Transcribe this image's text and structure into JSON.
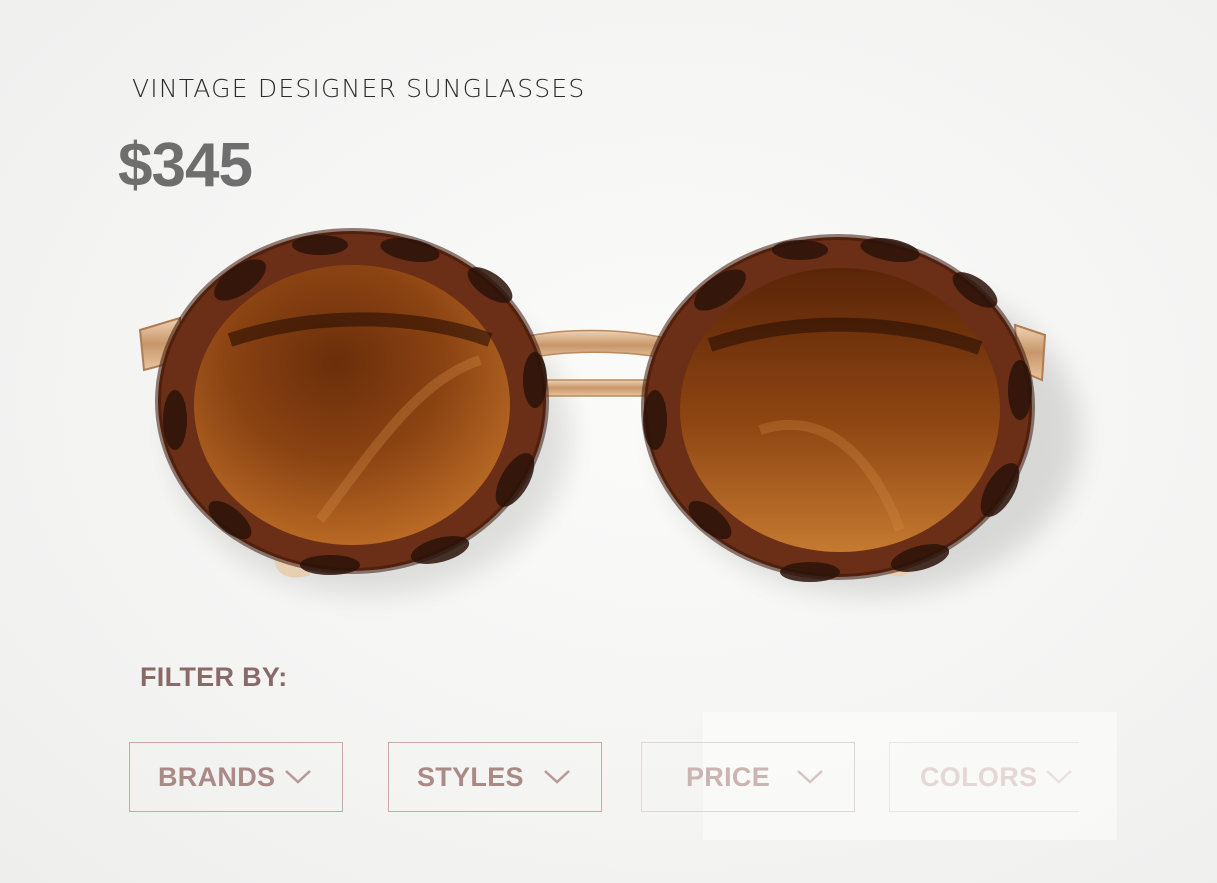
{
  "product": {
    "title": "VINTAGE DESIGNER SUNGLASSES",
    "price": "$345",
    "image_subject": "tortoiseshell round sunglasses"
  },
  "filters": {
    "label": "FILTER BY:",
    "items": [
      {
        "label": "BRANDS",
        "icon": "chevron-down-icon"
      },
      {
        "label": "STYLES",
        "icon": "chevron-down-icon"
      },
      {
        "label": "PRICE",
        "icon": "chevron-down-icon"
      },
      {
        "label": "COLORS",
        "icon": "chevron-down-icon"
      }
    ]
  },
  "colors": {
    "background": "#f6f6f5",
    "accent": "#a98a86",
    "price": "#6e6e6e",
    "frame": "#6b2e16",
    "lens": "#8a4212",
    "metal": "#d4a77c"
  }
}
